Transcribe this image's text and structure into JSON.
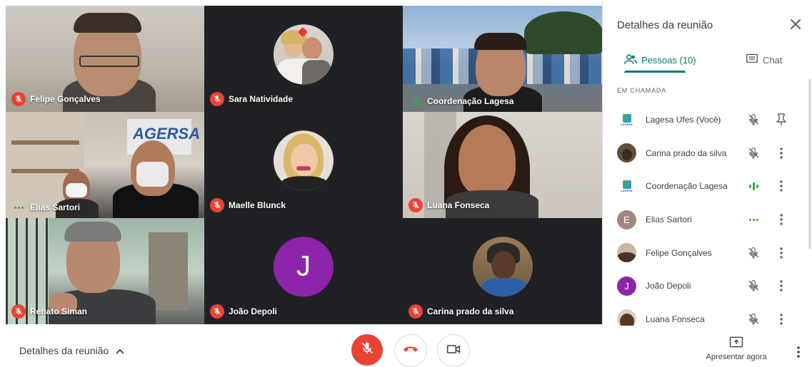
{
  "tiles": [
    {
      "name": "Felipe Gonçalves",
      "status": "muted"
    },
    {
      "name": "Sara Natividade",
      "status": "muted"
    },
    {
      "name": "Coordenação Lagesa",
      "status": "speaking"
    },
    {
      "name": "Elias Sartori",
      "status": "idle"
    },
    {
      "name": "Maelle Blunck",
      "status": "muted"
    },
    {
      "name": "Luana Fonseca",
      "status": "muted"
    },
    {
      "name": "Renato Siman",
      "status": "muted"
    },
    {
      "name": "João Depoli",
      "status": "muted",
      "initial": "J"
    },
    {
      "name": "Carina prado da silva",
      "status": "muted"
    }
  ],
  "panel": {
    "title": "Detalhes da reunião",
    "tab_people": "Pessoas (10)",
    "tab_chat": "Chat",
    "section": "EM CHAMADA",
    "participants": [
      {
        "name": "Lagesa Ufes (Você)",
        "status": "muted",
        "action": "pin-icon",
        "avatar_text": "LAGESA"
      },
      {
        "name": "Carina prado da silva",
        "status": "muted",
        "action": "more-icon"
      },
      {
        "name": "Coordenação Lagesa",
        "status": "speaking",
        "action": "more-icon",
        "avatar_text": "LAGESA"
      },
      {
        "name": "Elias Sartori",
        "status": "idle",
        "action": "more-icon",
        "initial": "E"
      },
      {
        "name": "Felipe Gonçalves",
        "status": "muted",
        "action": "more-icon"
      },
      {
        "name": "João Depoli",
        "status": "muted",
        "action": "more-icon",
        "initial": "J"
      },
      {
        "name": "Luana Fonseca",
        "status": "muted",
        "action": "more-icon"
      }
    ]
  },
  "bottom": {
    "details_label": "Detalhes da reunião",
    "present_label": "Apresentar agora"
  },
  "colors": {
    "accent": "#00796b",
    "muted_red": "#ea4335",
    "speaking_green": "#34a853",
    "avatar_purple": "#8e24aa"
  }
}
